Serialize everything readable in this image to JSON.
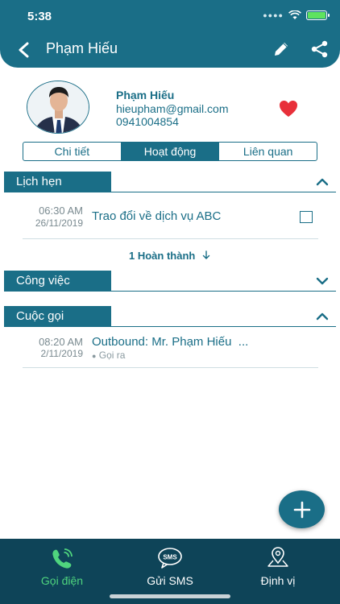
{
  "status_bar": {
    "time": "5:38",
    "battery_level": 0.9
  },
  "header": {
    "title": "Phạm Hiếu"
  },
  "contact": {
    "name": "Phạm Hiếu",
    "email": "hieupham@gmail.com",
    "phone": "0941004854",
    "favorite": true
  },
  "tabs": [
    {
      "label": "Chi tiết",
      "active": false
    },
    {
      "label": "Hoạt động",
      "active": true
    },
    {
      "label": "Liên quan",
      "active": false
    }
  ],
  "sections": {
    "appointments": {
      "label": "Lịch hẹn",
      "expanded": true,
      "items": [
        {
          "time": "06:30 AM",
          "date": "26/11/2019",
          "title": "Trao đổi về dịch vụ ABC",
          "checked": false
        }
      ],
      "completed_label": "1 Hoàn thành"
    },
    "tasks": {
      "label": "Công việc",
      "expanded": false
    },
    "calls": {
      "label": "Cuộc gọi",
      "expanded": true,
      "items": [
        {
          "time": "08:20 AM",
          "date": "2/11/2019",
          "title": "Outbound: Mr. Phạm Hiếu",
          "ellipsis": "...",
          "type": "Gọi ra"
        }
      ]
    }
  },
  "fab": {
    "icon": "plus-icon"
  },
  "bottom_nav": [
    {
      "label": "Gọi điện",
      "icon": "phone-icon",
      "active": true
    },
    {
      "label": "Gửi SMS",
      "icon": "sms-icon",
      "active": false
    },
    {
      "label": "Định vị",
      "icon": "location-pin-icon",
      "active": false
    }
  ],
  "colors": {
    "primary": "#1a6e87",
    "nav_bg": "#0e4458",
    "active_nav": "#4fd47e",
    "heart": "#e8303a"
  }
}
